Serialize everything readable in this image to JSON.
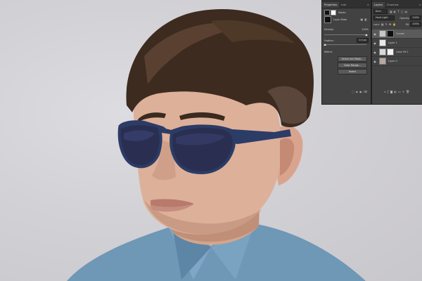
{
  "photo": {
    "subject": "Man with dark aviator sunglasses",
    "background_color": "#d1d0d4",
    "shirt_color": "#6f97b6",
    "hair_color": "#3d2b20",
    "lens_color": "#2a2f52",
    "frame_color": "#2b3c66"
  },
  "properties_panel": {
    "tabs": [
      "Properties",
      "Info"
    ],
    "mode_label": "Masks",
    "mask_type": "Layer Mask",
    "density_label": "Density:",
    "density_value": "100%",
    "density": 1.0,
    "feather_label": "Feather:",
    "feather_value": "0.0 px",
    "feather": 0.0,
    "refine_label": "Refine:",
    "buttons": [
      "Select and Mask...",
      "Color Range...",
      "Invert"
    ]
  },
  "layers_panel": {
    "tabs": [
      "Layers",
      "Channels"
    ],
    "filter_label": "Kind",
    "blend_mode": "Hard Light",
    "opacity_label": "Opacity:",
    "opacity_value": "100%",
    "lock_label": "Lock:",
    "fill_label": "Fill:",
    "fill_value": "100%",
    "layers": [
      {
        "name": "Curves",
        "selected": true
      },
      {
        "name": "Layer 1",
        "selected": false
      },
      {
        "name": "Color Fill 1",
        "selected": false
      },
      {
        "name": "Layer 0",
        "selected": false
      }
    ],
    "footer_icons": [
      "link-icon",
      "fx-icon",
      "mask-icon",
      "adjustment-icon",
      "folder-icon",
      "new-layer-icon",
      "trash-icon"
    ]
  },
  "colors": {
    "panel_bg": "#424242",
    "panel_dark": "#303030",
    "selected_row": "#5b5b5b"
  }
}
